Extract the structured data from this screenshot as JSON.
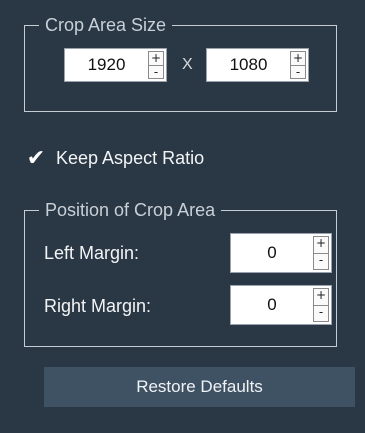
{
  "crop_area_size": {
    "title": "Crop Area Size",
    "width": "1920",
    "height": "1080",
    "separator": "X"
  },
  "spinner": {
    "plus": "+",
    "minus": "-"
  },
  "keep_aspect_ratio": {
    "label": "Keep Aspect Ratio",
    "checked": true,
    "check_glyph": "✔"
  },
  "position_of_crop_area": {
    "title": "Position of Crop Area",
    "left_margin_label": "Left Margin:",
    "left_margin_value": "0",
    "right_margin_label": "Right Margin:",
    "right_margin_value": "0"
  },
  "restore_defaults_label": "Restore Defaults",
  "colors": {
    "background": "#2a3845",
    "button": "#3e5263",
    "border": "#c4ccd4"
  }
}
